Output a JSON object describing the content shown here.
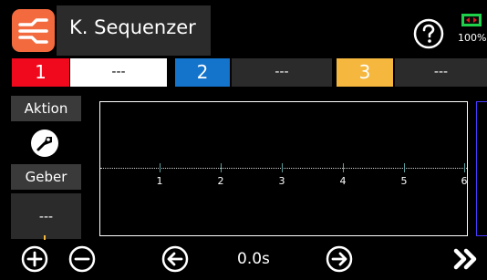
{
  "header": {
    "app_icon": "sequencer-icon",
    "title": "K. Sequenzer",
    "help_icon": "help-icon",
    "battery_icon": "battery-icon",
    "battery_pct": "100%"
  },
  "slots": [
    {
      "number": "1",
      "value": "---",
      "color": "#f0081d"
    },
    {
      "number": "2",
      "value": "---",
      "color": "#1474cc"
    },
    {
      "number": "3",
      "value": "---",
      "color": "#f5b73e"
    }
  ],
  "left_panel": {
    "aktion_label": "Aktion",
    "aktion_icon": "action-icon",
    "geber_label": "Geber",
    "geber_value": "---"
  },
  "graph": {
    "tick_labels": [
      "1",
      "2",
      "3",
      "4",
      "5",
      "6"
    ]
  },
  "toolbar": {
    "add_icon": "plus-circle-icon",
    "remove_icon": "minus-circle-icon",
    "prev_icon": "arrow-left-circle-icon",
    "time": "0.0s",
    "next_icon": "arrow-right-circle-icon",
    "forward_icon": "double-chevron-right-icon"
  }
}
